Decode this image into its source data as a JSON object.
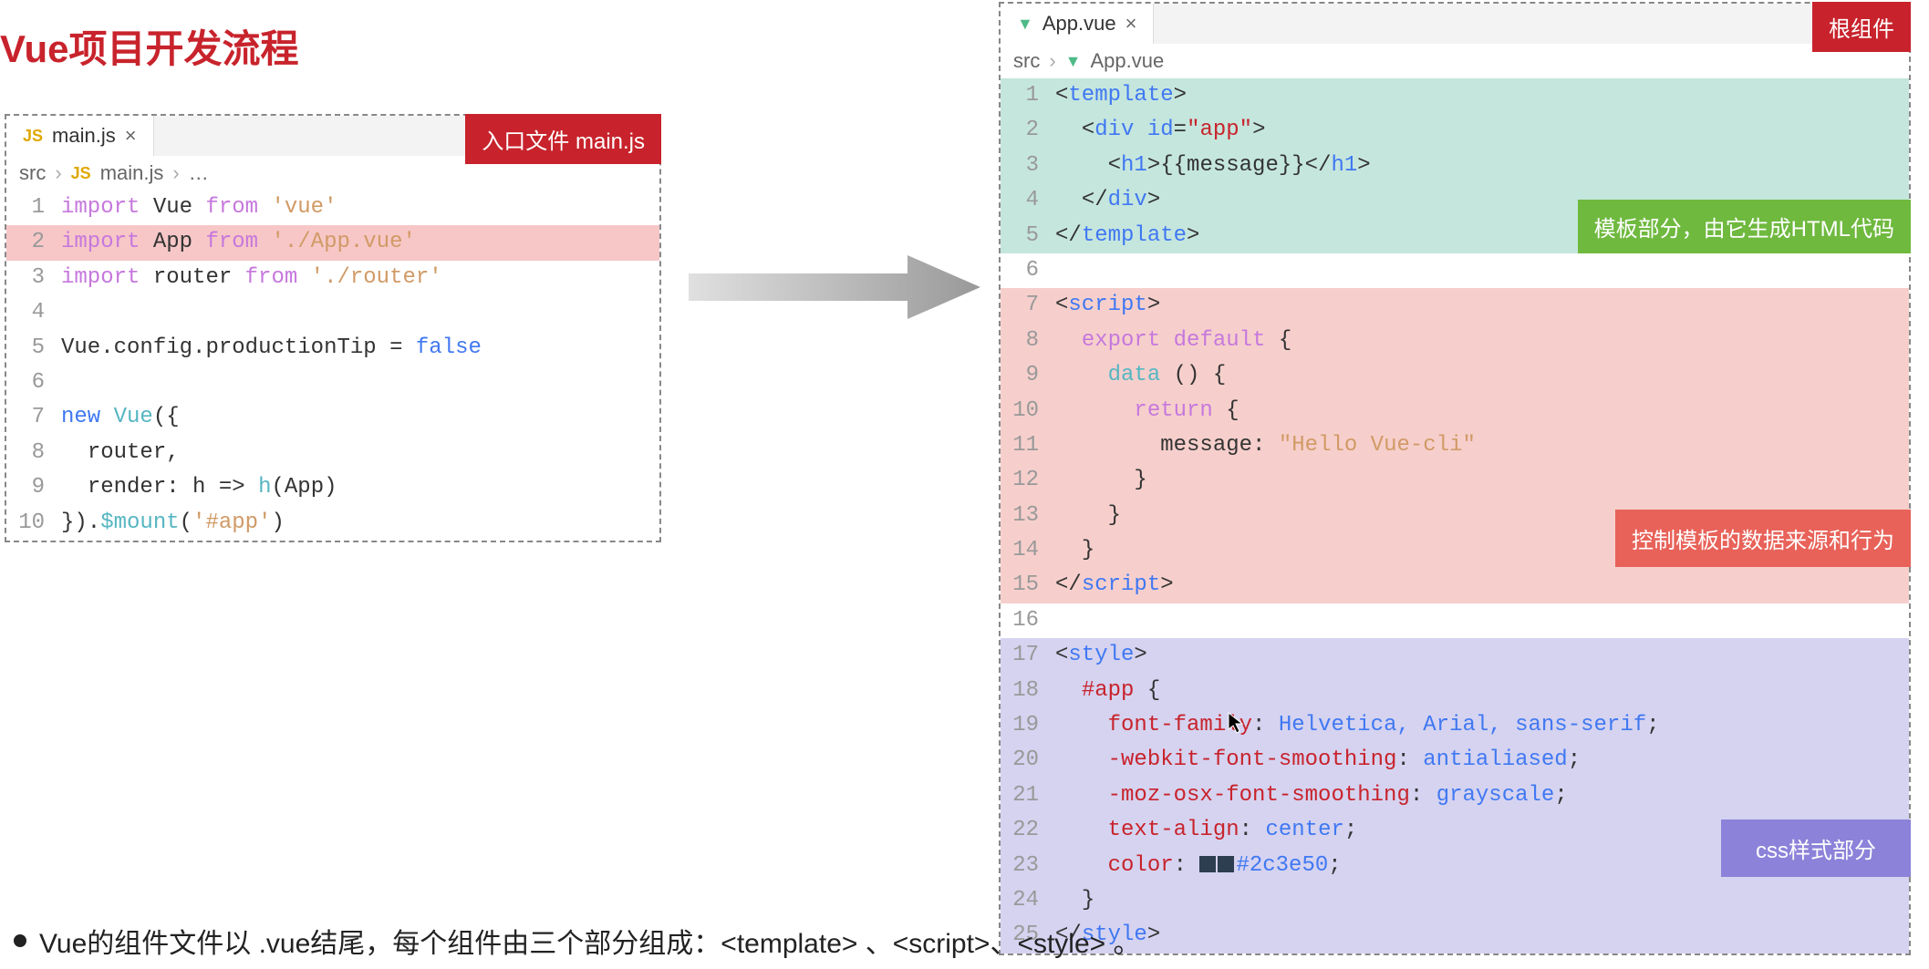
{
  "title": "Vue项目开发流程",
  "left": {
    "tab": {
      "icon_label": "JS",
      "name": "main.js"
    },
    "badge": "入口文件 main.js",
    "breadcrumb": {
      "root": "src",
      "icon_label": "JS",
      "file": "main.js",
      "trail": "…"
    },
    "lines": [
      {
        "n": "1",
        "tokens": [
          [
            "kw",
            "import"
          ],
          [
            "sp",
            " "
          ],
          [
            "ident",
            "Vue"
          ],
          [
            "sp",
            " "
          ],
          [
            "from",
            "from"
          ],
          [
            "sp",
            " "
          ],
          [
            "str",
            "'vue'"
          ]
        ]
      },
      {
        "n": "2",
        "hl": true,
        "tokens": [
          [
            "kw",
            "import"
          ],
          [
            "sp",
            " "
          ],
          [
            "ident",
            "App"
          ],
          [
            "sp",
            " "
          ],
          [
            "from",
            "from"
          ],
          [
            "sp",
            " "
          ],
          [
            "str",
            "'./App.vue'"
          ]
        ]
      },
      {
        "n": "3",
        "tokens": [
          [
            "kw",
            "import"
          ],
          [
            "sp",
            " "
          ],
          [
            "ident",
            "router"
          ],
          [
            "sp",
            " "
          ],
          [
            "from",
            "from"
          ],
          [
            "sp",
            " "
          ],
          [
            "str",
            "'./router'"
          ]
        ]
      },
      {
        "n": "4",
        "tokens": []
      },
      {
        "n": "5",
        "tokens": [
          [
            "ident",
            "Vue"
          ],
          [
            "punct",
            "."
          ],
          [
            "ident",
            "config"
          ],
          [
            "punct",
            "."
          ],
          [
            "ident",
            "productionTip"
          ],
          [
            "sp",
            " "
          ],
          [
            "punct",
            "="
          ],
          [
            "sp",
            " "
          ],
          [
            "bool",
            "false"
          ]
        ]
      },
      {
        "n": "6",
        "tokens": []
      },
      {
        "n": "7",
        "tokens": [
          [
            "new",
            "new"
          ],
          [
            "sp",
            " "
          ],
          [
            "fn",
            "Vue"
          ],
          [
            "punct",
            "({"
          ]
        ]
      },
      {
        "n": "8",
        "tokens": [
          [
            "sp",
            "  "
          ],
          [
            "ident",
            "router"
          ],
          [
            "punct",
            ","
          ]
        ]
      },
      {
        "n": "9",
        "tokens": [
          [
            "sp",
            "  "
          ],
          [
            "ident",
            "render"
          ],
          [
            "punct",
            ":"
          ],
          [
            "sp",
            " "
          ],
          [
            "ident",
            "h"
          ],
          [
            "sp",
            " "
          ],
          [
            "punct",
            "=>"
          ],
          [
            "sp",
            " "
          ],
          [
            "fn",
            "h"
          ],
          [
            "punct",
            "("
          ],
          [
            "ident",
            "App"
          ],
          [
            "punct",
            ")"
          ]
        ]
      },
      {
        "n": "10",
        "tokens": [
          [
            "punct",
            "})."
          ],
          [
            "fn",
            "$mount"
          ],
          [
            "punct",
            "("
          ],
          [
            "str",
            "'#app'"
          ],
          [
            "punct",
            ")"
          ]
        ]
      }
    ]
  },
  "right": {
    "tab": {
      "name": "App.vue"
    },
    "badge": "根组件",
    "breadcrumb": {
      "root": "src",
      "file": "App.vue"
    },
    "labels": {
      "template": "模板部分，由它生成HTML代码",
      "script": "控制模板的数据来源和行为",
      "style": "css样式部分"
    },
    "lines": [
      {
        "n": "1",
        "section": "template",
        "tokens": [
          [
            "punct",
            "<"
          ],
          [
            "tag",
            "template"
          ],
          [
            "punct",
            ">"
          ]
        ]
      },
      {
        "n": "2",
        "section": "template",
        "tokens": [
          [
            "sp",
            "  "
          ],
          [
            "punct",
            "<"
          ],
          [
            "tag",
            "div"
          ],
          [
            "sp",
            " "
          ],
          [
            "attr",
            "id"
          ],
          [
            "punct",
            "="
          ],
          [
            "attrv",
            "\"app\""
          ],
          [
            "punct",
            ">"
          ]
        ]
      },
      {
        "n": "3",
        "section": "template",
        "tokens": [
          [
            "sp",
            "    "
          ],
          [
            "punct",
            "<"
          ],
          [
            "tag",
            "h1"
          ],
          [
            "punct",
            ">"
          ],
          [
            "ident",
            "{{message}}"
          ],
          [
            "punct",
            "</"
          ],
          [
            "tag",
            "h1"
          ],
          [
            "punct",
            ">"
          ]
        ]
      },
      {
        "n": "4",
        "section": "template",
        "tokens": [
          [
            "sp",
            "  "
          ],
          [
            "punct",
            "</"
          ],
          [
            "tag",
            "div"
          ],
          [
            "punct",
            ">"
          ]
        ]
      },
      {
        "n": "5",
        "section": "template",
        "tokens": [
          [
            "punct",
            "</"
          ],
          [
            "tag",
            "template"
          ],
          [
            "punct",
            ">"
          ]
        ]
      },
      {
        "n": "6",
        "section": "gap",
        "tokens": []
      },
      {
        "n": "7",
        "section": "script",
        "tokens": [
          [
            "punct",
            "<"
          ],
          [
            "tag",
            "script"
          ],
          [
            "punct",
            ">"
          ]
        ]
      },
      {
        "n": "8",
        "section": "script",
        "tokens": [
          [
            "sp",
            "  "
          ],
          [
            "export",
            "export"
          ],
          [
            "sp",
            " "
          ],
          [
            "default",
            "default"
          ],
          [
            "sp",
            " "
          ],
          [
            "punct",
            "{"
          ]
        ]
      },
      {
        "n": "9",
        "section": "script",
        "tokens": [
          [
            "sp",
            "    "
          ],
          [
            "fn",
            "data"
          ],
          [
            "sp",
            " "
          ],
          [
            "punct",
            "() {"
          ]
        ]
      },
      {
        "n": "10",
        "section": "script",
        "tokens": [
          [
            "sp",
            "      "
          ],
          [
            "return",
            "return"
          ],
          [
            "sp",
            " "
          ],
          [
            "punct",
            "{"
          ]
        ]
      },
      {
        "n": "11",
        "section": "script",
        "tokens": [
          [
            "sp",
            "        "
          ],
          [
            "key",
            "message"
          ],
          [
            "punct",
            ":"
          ],
          [
            "sp",
            " "
          ],
          [
            "str",
            "\"Hello Vue-cli\""
          ]
        ]
      },
      {
        "n": "12",
        "section": "script",
        "tokens": [
          [
            "sp",
            "      "
          ],
          [
            "punct",
            "}"
          ]
        ]
      },
      {
        "n": "13",
        "section": "script",
        "tokens": [
          [
            "sp",
            "    "
          ],
          [
            "punct",
            "}"
          ]
        ]
      },
      {
        "n": "14",
        "section": "script",
        "tokens": [
          [
            "sp",
            "  "
          ],
          [
            "punct",
            "}"
          ]
        ]
      },
      {
        "n": "15",
        "section": "script",
        "tokens": [
          [
            "punct",
            "</"
          ],
          [
            "tag",
            "script"
          ],
          [
            "punct",
            ">"
          ]
        ]
      },
      {
        "n": "16",
        "section": "gap",
        "tokens": []
      },
      {
        "n": "17",
        "section": "style",
        "tokens": [
          [
            "punct",
            "<"
          ],
          [
            "tag",
            "style"
          ],
          [
            "punct",
            ">"
          ]
        ]
      },
      {
        "n": "18",
        "section": "style",
        "tokens": [
          [
            "sp",
            "  "
          ],
          [
            "cssselector",
            "#app"
          ],
          [
            "sp",
            " "
          ],
          [
            "punct",
            "{"
          ]
        ]
      },
      {
        "n": "19",
        "section": "style",
        "tokens": [
          [
            "sp",
            "    "
          ],
          [
            "cssprop",
            "font-family"
          ],
          [
            "punct",
            ":"
          ],
          [
            "sp",
            " "
          ],
          [
            "cssval",
            "Helvetica, Arial, sans-serif"
          ],
          [
            "punct",
            ";"
          ]
        ]
      },
      {
        "n": "20",
        "section": "style",
        "tokens": [
          [
            "sp",
            "    "
          ],
          [
            "cssprop",
            "-webkit-font-smoothing"
          ],
          [
            "punct",
            ":"
          ],
          [
            "sp",
            " "
          ],
          [
            "cssval",
            "antialiased"
          ],
          [
            "punct",
            ";"
          ]
        ]
      },
      {
        "n": "21",
        "section": "style",
        "tokens": [
          [
            "sp",
            "    "
          ],
          [
            "cssprop",
            "-moz-osx-font-smoothing"
          ],
          [
            "punct",
            ":"
          ],
          [
            "sp",
            " "
          ],
          [
            "cssval",
            "grayscale"
          ],
          [
            "punct",
            ";"
          ]
        ]
      },
      {
        "n": "22",
        "section": "style",
        "tokens": [
          [
            "sp",
            "    "
          ],
          [
            "cssprop",
            "text-align"
          ],
          [
            "punct",
            ":"
          ],
          [
            "sp",
            " "
          ],
          [
            "cssval",
            "center"
          ],
          [
            "punct",
            ";"
          ]
        ]
      },
      {
        "n": "23",
        "section": "style",
        "tokens": [
          [
            "sp",
            "    "
          ],
          [
            "cssprop",
            "color"
          ],
          [
            "punct",
            ":"
          ],
          [
            "sp",
            " "
          ],
          [
            "swatch",
            ""
          ],
          [
            "swatch",
            ""
          ],
          [
            "cssval",
            "#2c3e50"
          ],
          [
            "punct",
            ";"
          ]
        ]
      },
      {
        "n": "24",
        "section": "style",
        "tokens": [
          [
            "sp",
            "  "
          ],
          [
            "punct",
            "}"
          ]
        ]
      },
      {
        "n": "25",
        "section": "style",
        "tokens": [
          [
            "punct",
            "</"
          ],
          [
            "tag",
            "style"
          ],
          [
            "punct",
            ">"
          ]
        ]
      }
    ]
  },
  "bullet": "Vue的组件文件以 .vue结尾，每个组件由三个部分组成：<template> 、<script>、<style> 。"
}
